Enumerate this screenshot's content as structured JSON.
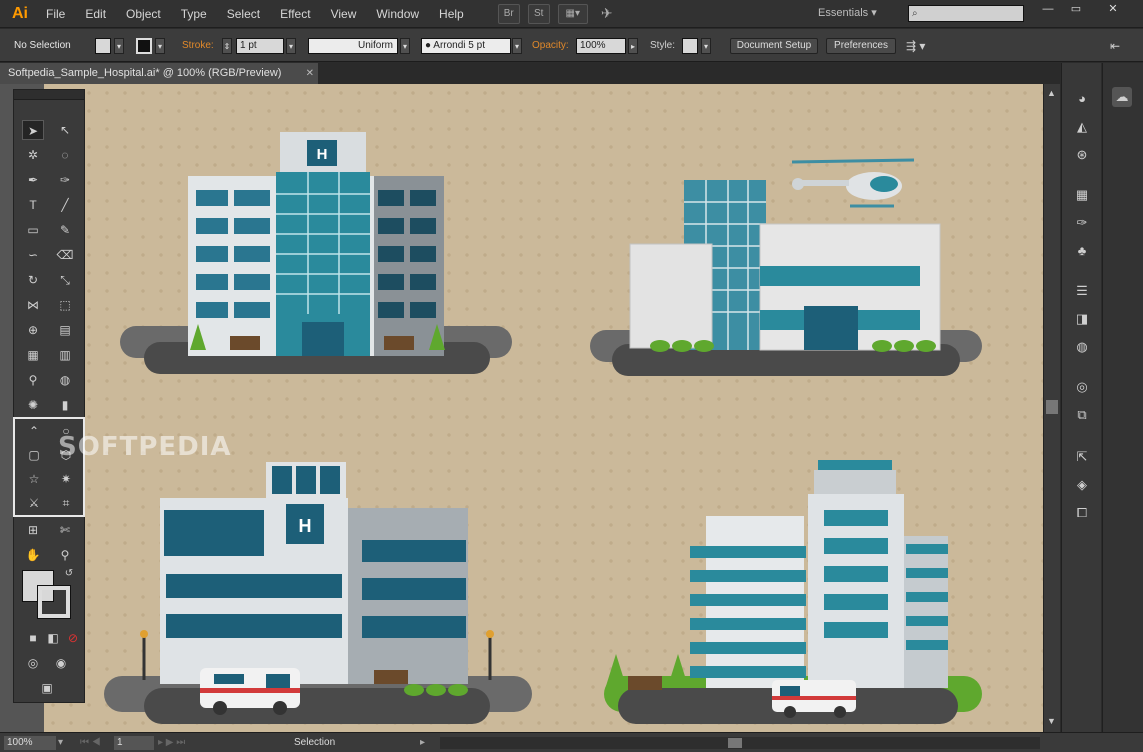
{
  "app": {
    "logo": "Ai"
  },
  "menu": [
    "File",
    "Edit",
    "Object",
    "Type",
    "Select",
    "Effect",
    "View",
    "Window",
    "Help"
  ],
  "workspace": "Essentials",
  "controlbar": {
    "selection": "No Selection",
    "stroke_label": "Stroke:",
    "stroke_value": "1 pt",
    "profile": "Uniform",
    "brush": "Arrondi 5 pt",
    "opacity_label": "Opacity:",
    "opacity_value": "100%",
    "style_label": "Style:",
    "document_setup": "Document Setup",
    "preferences": "Preferences"
  },
  "document": {
    "tab_title": "Softpedia_Sample_Hospital.ai* @ 100% (RGB/Preview)"
  },
  "status": {
    "zoom": "100%",
    "page": "1",
    "tool": "Selection"
  },
  "watermark": "SOFTPEDIA",
  "colors": {
    "accent": "#ff9a00",
    "artboard": "#cbb99a",
    "teal": "#2a8a9c",
    "dark_teal": "#1d5f78"
  }
}
